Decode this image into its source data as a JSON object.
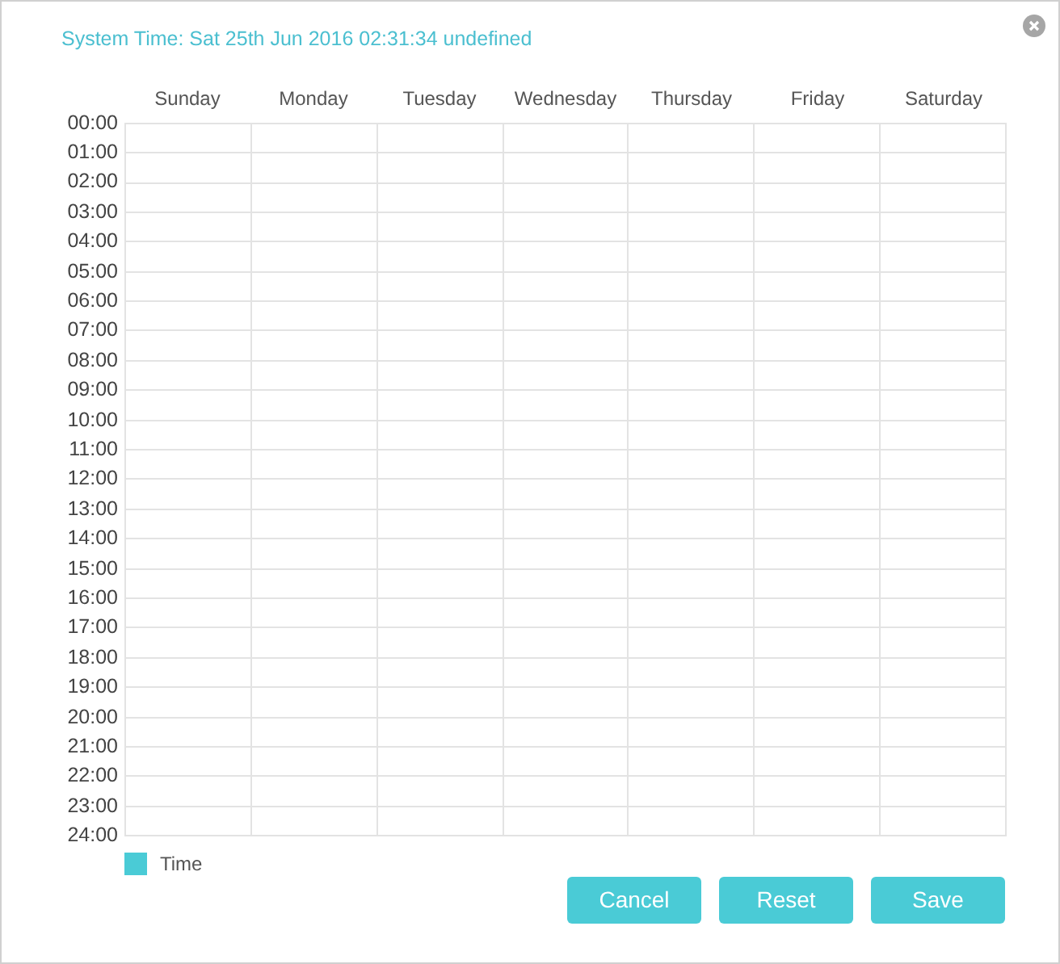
{
  "system_time": "System Time: Sat 25th Jun 2016 02:31:34 undefined",
  "days": [
    "Sunday",
    "Monday",
    "Tuesday",
    "Wednesday",
    "Thursday",
    "Friday",
    "Saturday"
  ],
  "hours": [
    "00:00",
    "01:00",
    "02:00",
    "03:00",
    "04:00",
    "05:00",
    "06:00",
    "07:00",
    "08:00",
    "09:00",
    "10:00",
    "11:00",
    "12:00",
    "13:00",
    "14:00",
    "15:00",
    "16:00",
    "17:00",
    "18:00",
    "19:00",
    "20:00",
    "21:00",
    "22:00",
    "23:00",
    "24:00"
  ],
  "legend": {
    "label": "Time",
    "color": "#4acbd6"
  },
  "buttons": [
    "Cancel",
    "Reset",
    "Save"
  ]
}
